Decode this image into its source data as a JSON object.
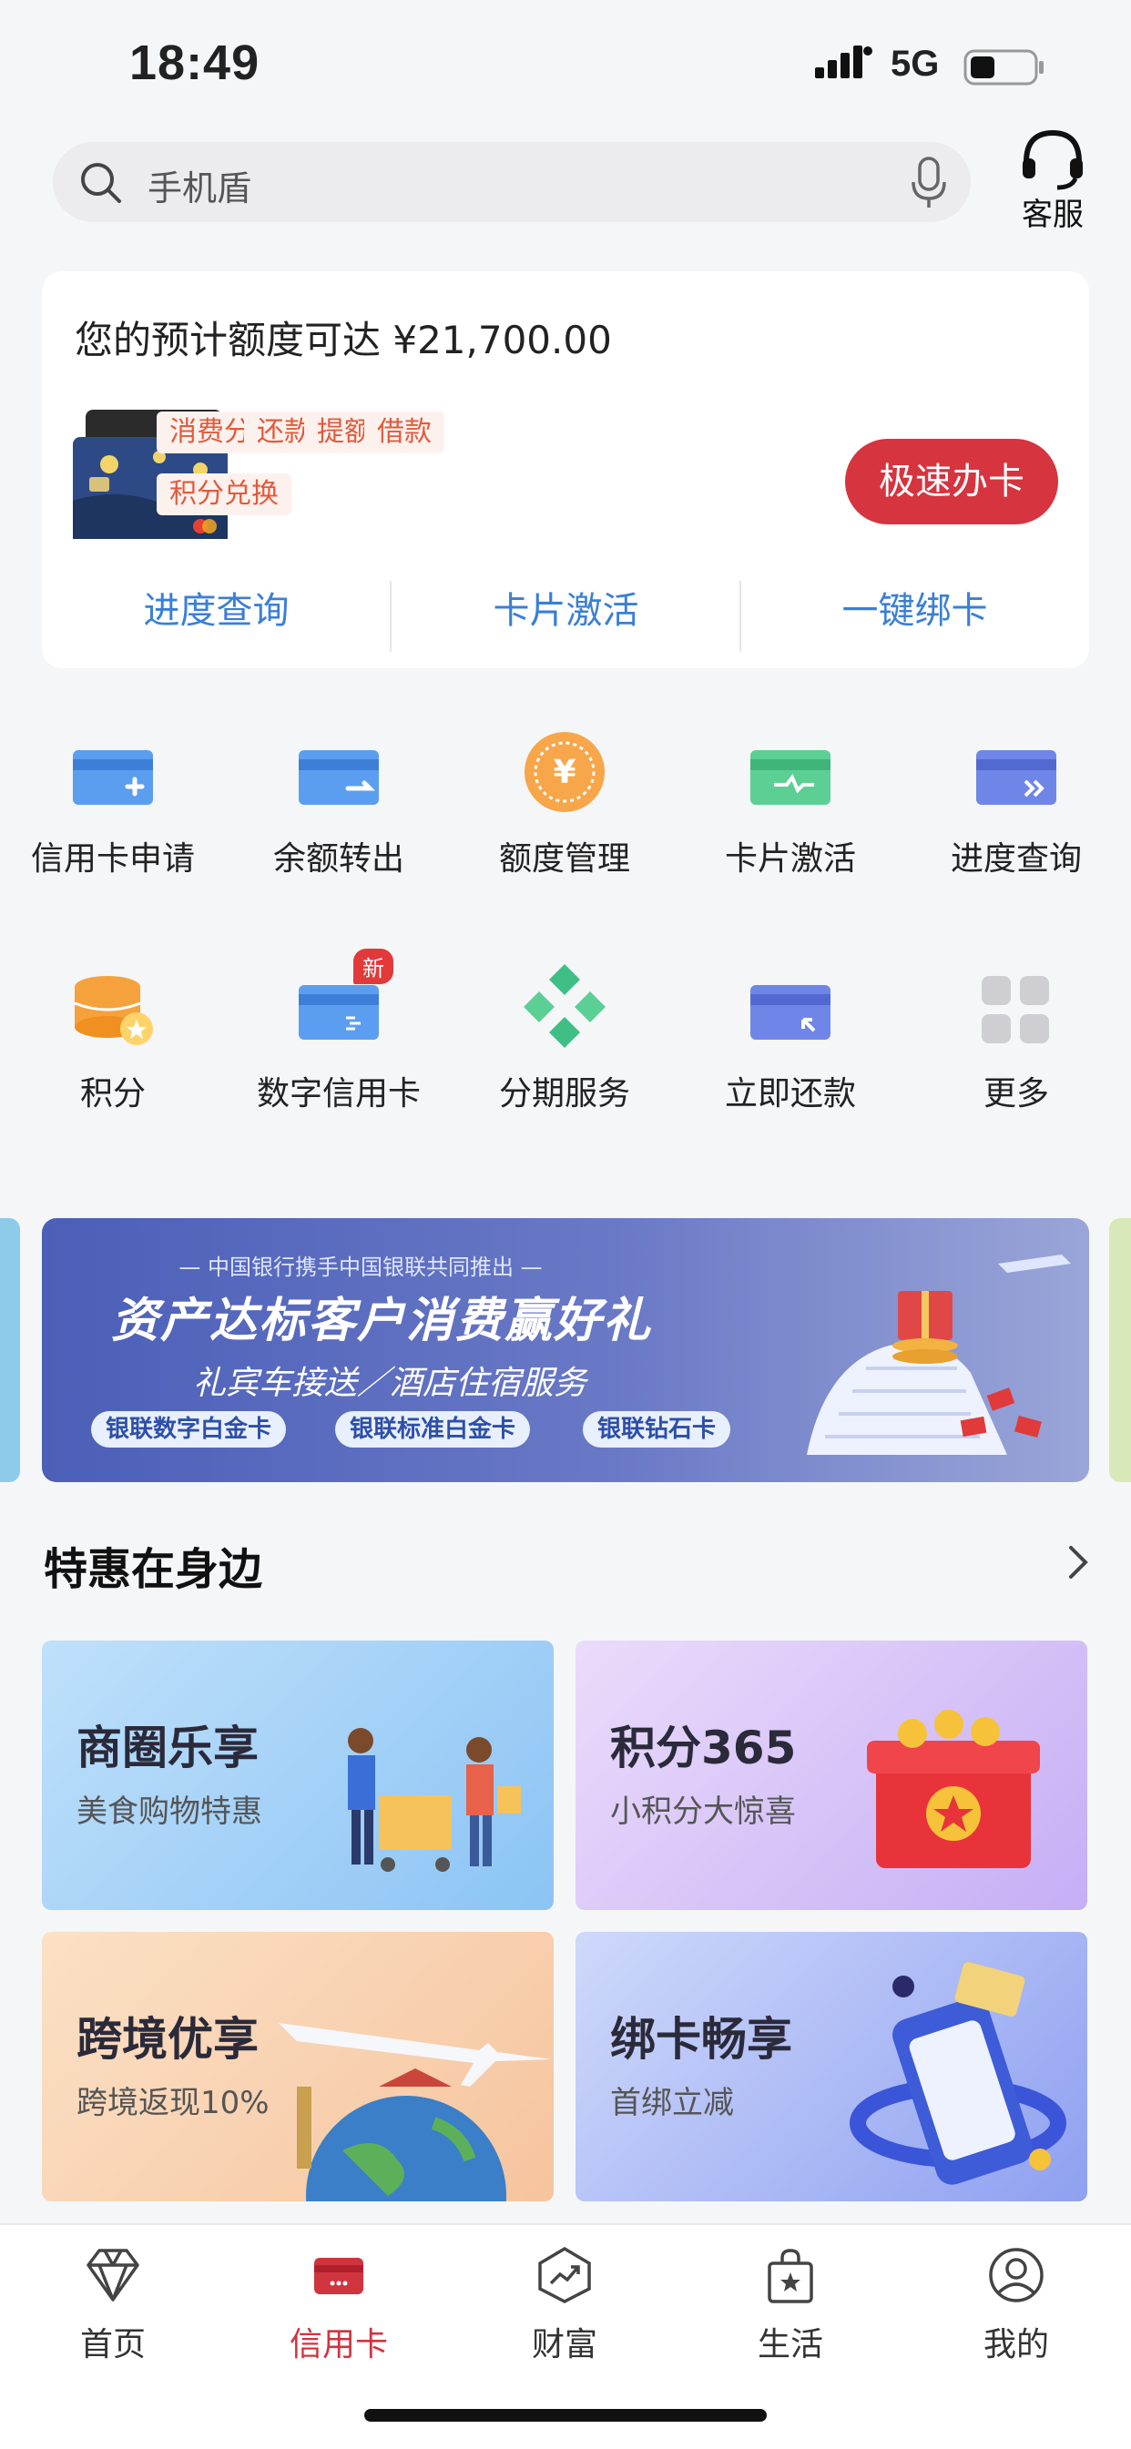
{
  "status_bar": {
    "time": "18:49",
    "network": "5G"
  },
  "search": {
    "placeholder": "手机盾"
  },
  "customer_service": {
    "label": "客服"
  },
  "quota_card": {
    "title": "您的预计额度可达 ¥21,700.00",
    "tags": [
      "消费分期",
      "还款",
      "提额",
      "借款",
      "积分兑换"
    ],
    "apply_button": "极速办卡",
    "links": [
      "进度查询",
      "卡片激活",
      "一键绑卡"
    ]
  },
  "quick_grid": [
    {
      "label": "信用卡申请",
      "icon": "card-plus-icon"
    },
    {
      "label": "余额转出",
      "icon": "card-transfer-icon"
    },
    {
      "label": "额度管理",
      "icon": "yuan-coin-icon"
    },
    {
      "label": "卡片激活",
      "icon": "card-activate-icon"
    },
    {
      "label": "进度查询",
      "icon": "card-progress-icon"
    },
    {
      "label": "积分",
      "icon": "points-stack-icon"
    },
    {
      "label": "数字信用卡",
      "icon": "digital-card-icon",
      "badge": "新"
    },
    {
      "label": "分期服务",
      "icon": "installment-diamond-icon"
    },
    {
      "label": "立即还款",
      "icon": "card-repay-icon"
    },
    {
      "label": "更多",
      "icon": "grid-more-icon"
    }
  ],
  "banner": {
    "subtitle": "— 中国银行携手中国银联共同推出 —",
    "title": "资产达标客户消费赢好礼",
    "line2": "礼宾车接送／酒店住宿服务",
    "chips": [
      "银联数字白金卡",
      "银联标准白金卡",
      "银联钻石卡"
    ]
  },
  "section": {
    "title": "特惠在身边"
  },
  "promos": [
    {
      "title": "商圈乐享",
      "subtitle": "美食购物特惠"
    },
    {
      "title": "积分365",
      "subtitle": "小积分大惊喜"
    },
    {
      "title": "跨境优享",
      "subtitle": "跨境返现10%"
    },
    {
      "title": "绑卡畅享",
      "subtitle": "首绑立减"
    }
  ],
  "tabs": [
    {
      "label": "首页",
      "icon": "diamond-icon"
    },
    {
      "label": "信用卡",
      "icon": "credit-card-icon",
      "active": true
    },
    {
      "label": "财富",
      "icon": "wealth-chart-icon"
    },
    {
      "label": "生活",
      "icon": "shopping-bag-icon"
    },
    {
      "label": "我的",
      "icon": "profile-icon"
    }
  ],
  "colors": {
    "brand_red": "#d6343f",
    "link_blue": "#3a7fd6",
    "tag_text": "#e25a3a"
  }
}
